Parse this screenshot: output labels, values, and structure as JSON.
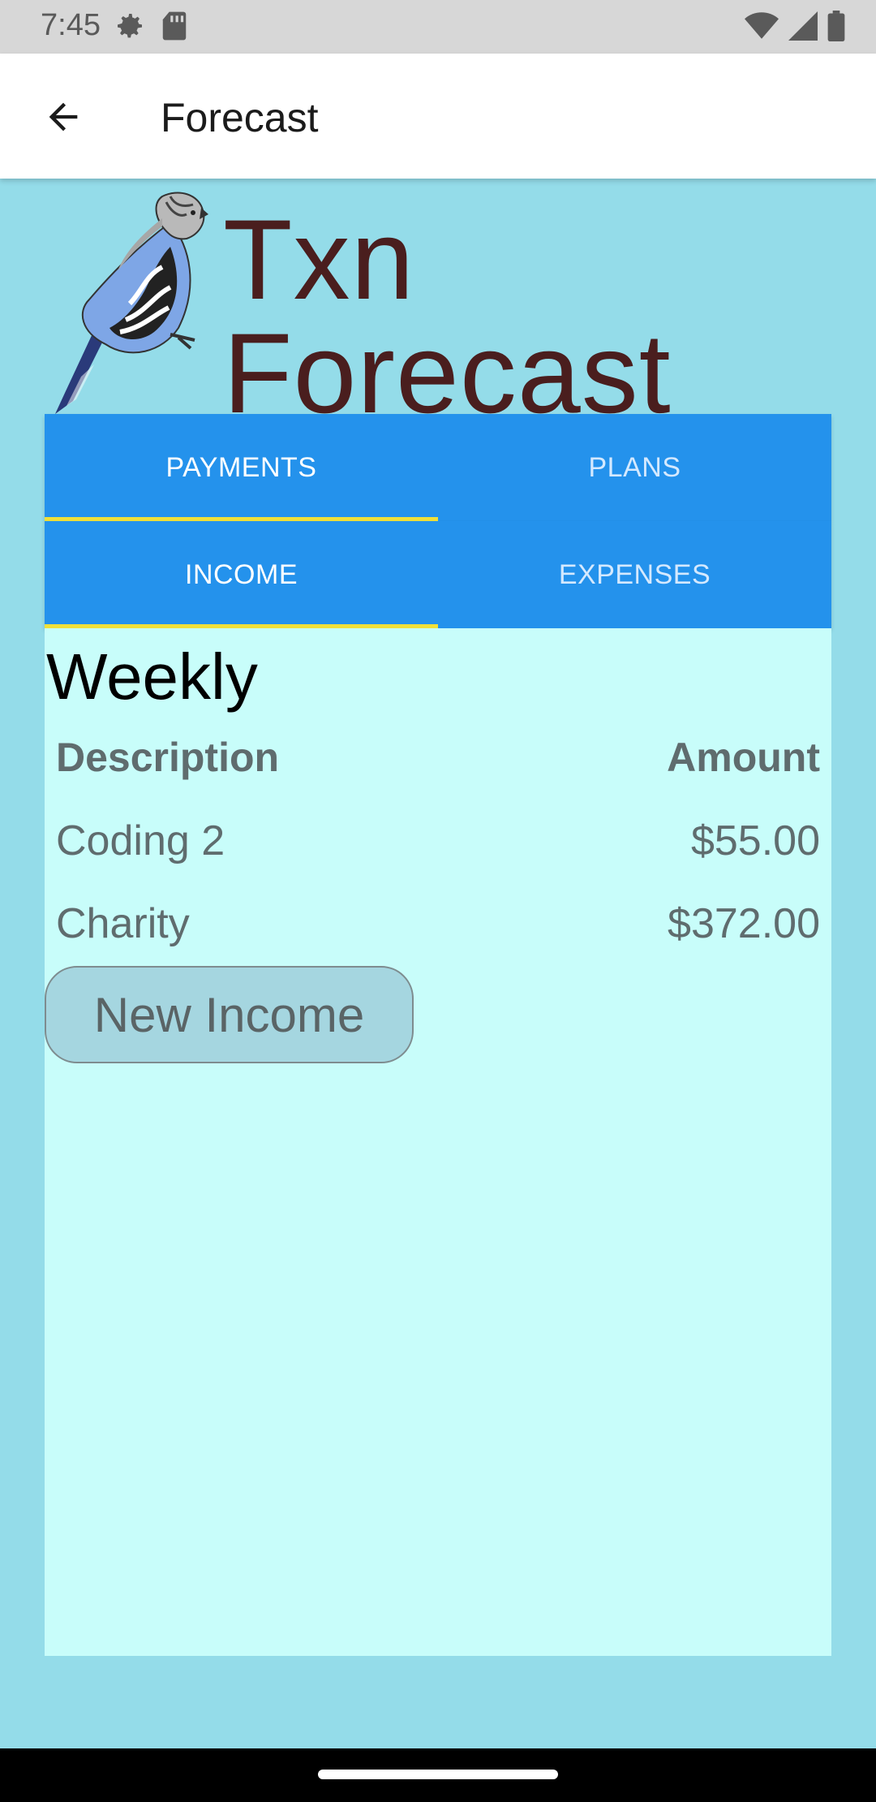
{
  "status_bar": {
    "time": "7:45",
    "left_icons": [
      "settings-gear-icon",
      "sd-card-icon"
    ],
    "right_icons": [
      "wifi-icon",
      "cell-signal-icon",
      "battery-icon"
    ]
  },
  "app_bar": {
    "back_icon": "arrow-back-icon",
    "title": "Forecast"
  },
  "brand": {
    "logo": "parakeet-bird-logo",
    "title": "Txn Forecast"
  },
  "main_tabs": [
    {
      "label": "PAYMENTS",
      "active": true
    },
    {
      "label": "PLANS",
      "active": false
    }
  ],
  "sub_tabs": [
    {
      "label": "INCOME",
      "active": true
    },
    {
      "label": "EXPENSES",
      "active": false
    }
  ],
  "content": {
    "section_title": "Weekly",
    "columns": {
      "description": "Description",
      "amount": "Amount"
    },
    "rows": [
      {
        "description": "Coding 2",
        "amount": "$55.00"
      },
      {
        "description": "Charity",
        "amount": "$372.00"
      }
    ],
    "new_button_label": "New Income"
  },
  "colors": {
    "background": "#94dce9",
    "tab_bar": "#2492ec",
    "tab_indicator": "#f0e03a",
    "content_panel": "#c8fdfa",
    "brand_title": "#4a1e1e"
  }
}
